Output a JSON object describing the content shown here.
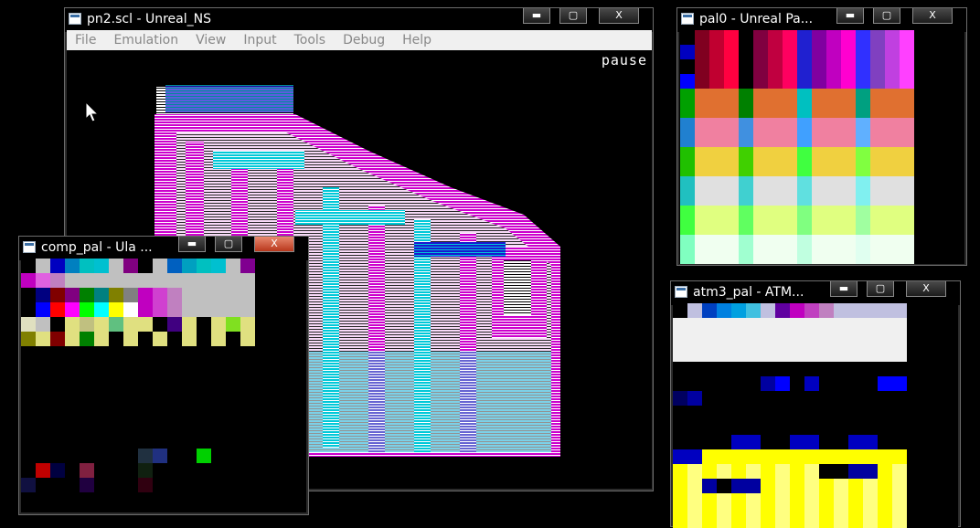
{
  "main_window": {
    "title": "pn2.scl - Unreal_NS",
    "menu": [
      "File",
      "Emulation",
      "View",
      "Input",
      "Tools",
      "Debug",
      "Help"
    ],
    "status_text": "pause"
  },
  "pal0_window": {
    "title": "pal0 - Unreal Pa..."
  },
  "comp_pal_window": {
    "title": "comp_pal - Ula ..."
  },
  "atm3_pal_window": {
    "title": "atm3_pal - ATM..."
  },
  "window_controls": {
    "minimize": "▬",
    "maximize": "▢",
    "close": "X"
  },
  "colors": {
    "magenta": "#cc00cc",
    "cyan": "#00c8d8",
    "blue": "#1010d0",
    "white": "#ffffff",
    "desktop": "#000000"
  }
}
